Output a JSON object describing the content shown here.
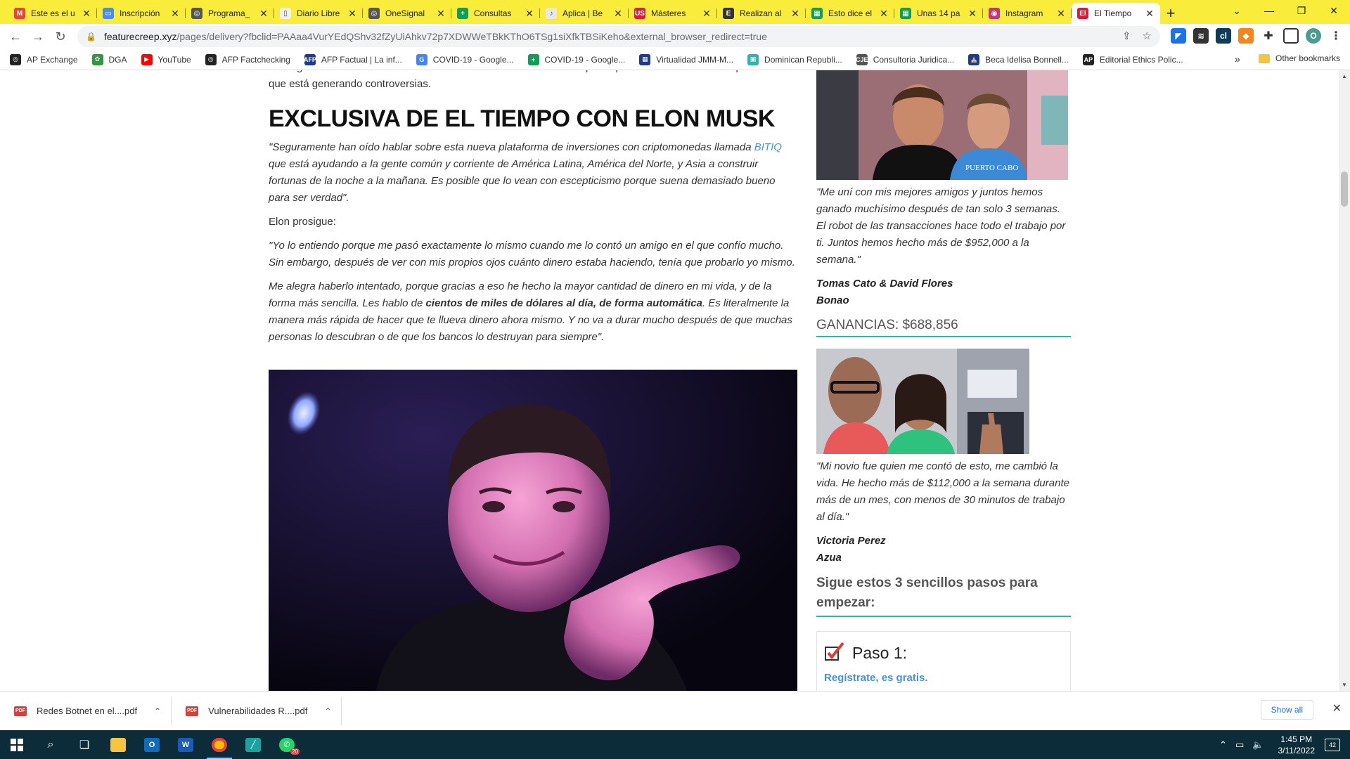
{
  "browser": {
    "tabs": [
      {
        "label": "Este es el u",
        "fav_color": "#ea4335",
        "fav_glyph": "M"
      },
      {
        "label": "Inscripción",
        "fav_color": "#4a8af4",
        "fav_glyph": "▭"
      },
      {
        "label": "Programa_",
        "fav_color": "#555555",
        "fav_glyph": "◎"
      },
      {
        "label": "Diario Libre",
        "fav_color": "#f0f0f0",
        "fav_glyph": "▯"
      },
      {
        "label": "OneSignal",
        "fav_color": "#555555",
        "fav_glyph": "◎"
      },
      {
        "label": "Consultas",
        "fav_color": "#0f9d58",
        "fav_glyph": "+"
      },
      {
        "label": "Aplica | Be",
        "fav_color": "#e8e8e8",
        "fav_glyph": "♪"
      },
      {
        "label": "Másteres",
        "fav_color": "#d81b3d",
        "fav_glyph": "US"
      },
      {
        "label": "Realizan al",
        "fav_color": "#333333",
        "fav_glyph": "E"
      },
      {
        "label": "Esto dice el",
        "fav_color": "#0f9d58",
        "fav_glyph": "▦"
      },
      {
        "label": "Unas 14 pa",
        "fav_color": "#0f9d58",
        "fav_glyph": "▦"
      },
      {
        "label": "Instagram",
        "fav_color": "#c13584",
        "fav_glyph": "◉"
      },
      {
        "label": "El Tiempo",
        "fav_color": "#d81b3d",
        "fav_glyph": "El",
        "active": true
      }
    ],
    "new_tab": "+",
    "url_host": "featurecreep.xyz",
    "url_rest": "/pages/delivery?fbclid=PAAaa4VurYEdQShv32fZyUiAhkv72p7XDWWeTBkKThO6TSg1siXfkTBSiKeho&external_browser_redirect=true",
    "bookmarks": [
      {
        "label": "AP Exchange",
        "color": "#222222",
        "glyph": "◎"
      },
      {
        "label": "DGA",
        "color": "#2e9a3c",
        "glyph": "✿"
      },
      {
        "label": "YouTube",
        "color": "#ff0000",
        "glyph": "▶"
      },
      {
        "label": "AFP Factchecking",
        "color": "#222222",
        "glyph": "◎"
      },
      {
        "label": "AFP Factual | La inf...",
        "color": "#1e3a8a",
        "glyph": "AFP"
      },
      {
        "label": "COVID-19 - Google...",
        "color": "#4285f4",
        "glyph": "G"
      },
      {
        "label": "COVID-19 - Google...",
        "color": "#0f9d58",
        "glyph": "+"
      },
      {
        "label": "Virtualidad JMM-M...",
        "color": "#1e3a8a",
        "glyph": "▦"
      },
      {
        "label": "Dominican Republi...",
        "color": "#2fb5ad",
        "glyph": "▣"
      },
      {
        "label": "Consultoria Juridica...",
        "color": "#555555",
        "glyph": "CJE"
      },
      {
        "label": "Beca Idelisa Bonnell...",
        "color": "#1e3a8a",
        "glyph": "⛪"
      },
      {
        "label": "Editorial Ethics Polic...",
        "color": "#222222",
        "glyph": "AP"
      }
    ],
    "bookmarks_more": "»",
    "other_bookmarks": "Other bookmarks"
  },
  "article": {
    "lead": "conseguimos una entrevista exclusiva con el mismísimo Elon Musk para aprender más sobre esta oportunidad que está generando controversias.",
    "headline": "EXCLUSIVA DE EL TIEMPO CON ELON MUSK",
    "p1_before": "\"Seguramente han oído hablar sobre esta nueva plataforma de inversiones con criptomonedas llamada ",
    "p1_link": "BITIQ",
    "p1_after": " que está ayudando a la gente común y corriente de América Latina, América del Norte, y Asia a construir fortunas de la noche a la mañana. Es posible que lo vean con escepticismo porque suena demasiado bueno para ser verdad\".",
    "p2": "Elon prosigue:",
    "p3": "\"Yo lo entiendo porque me pasó exactamente lo mismo cuando me lo contó un amigo en el que confío mucho. Sin embargo, después de ver con mis propios ojos cuánto dinero estaba haciendo, tenía que probarlo yo mismo.",
    "p4_before": "Me alegra haberlo intentado, porque gracias a eso he hecho la mayor cantidad de dinero en mi vida, y de la forma más sencilla. Les hablo de ",
    "p4_bold": "cientos de miles de dólares al día, de forma automática",
    "p4_after": ". Es literalmente la manera más rápida de hacer que te llueva dinero ahora mismo. Y no va a durar mucho después de que muchas personas lo descubran o de que los bancos lo destruyan para siempre\"."
  },
  "sidebar": {
    "testimonial1": {
      "quote": "\"Me uní con mis mejores amigos y juntos hemos ganado muchísimo después de tan solo 3 semanas. El robot de las transacciones hace todo el trabajo por ti. Juntos hemos hecho más de $952,000 a la semana.\"",
      "name": "Tomas Cato & David Flores",
      "city": "Bonao",
      "shirt_text": "PUERTO CABO"
    },
    "gain_label": "GANANCIAS: $688,856",
    "testimonial2": {
      "quote": "\"Mi novio fue quien me contó de esto, me cambió la vida. He hecho más de $112,000 a la semana durante más de un mes, con menos de 30 minutos de trabajo al día.\"",
      "name": "Victoria Perez",
      "city": "Azua"
    },
    "steps_title": "Sigue estos 3 sencillos pasos para empezar:",
    "step1_title": "Paso 1:",
    "step1_link": "Regístrate, es gratis."
  },
  "downloads": [
    {
      "label": "Redes Botnet en el....pdf"
    },
    {
      "label": "Vulnerabilidades R....pdf"
    }
  ],
  "downloads_show_all": "Show all",
  "taskbar": {
    "time": "1:45 PM",
    "date": "3/11/2022",
    "notification_count": "42",
    "whatsapp_badge": "20"
  },
  "colors": {
    "tabstrip": "#f9ec3a",
    "accent_teal": "#2fb5ad",
    "link": "#4a90d9",
    "taskbar": "#0c2c3a"
  }
}
